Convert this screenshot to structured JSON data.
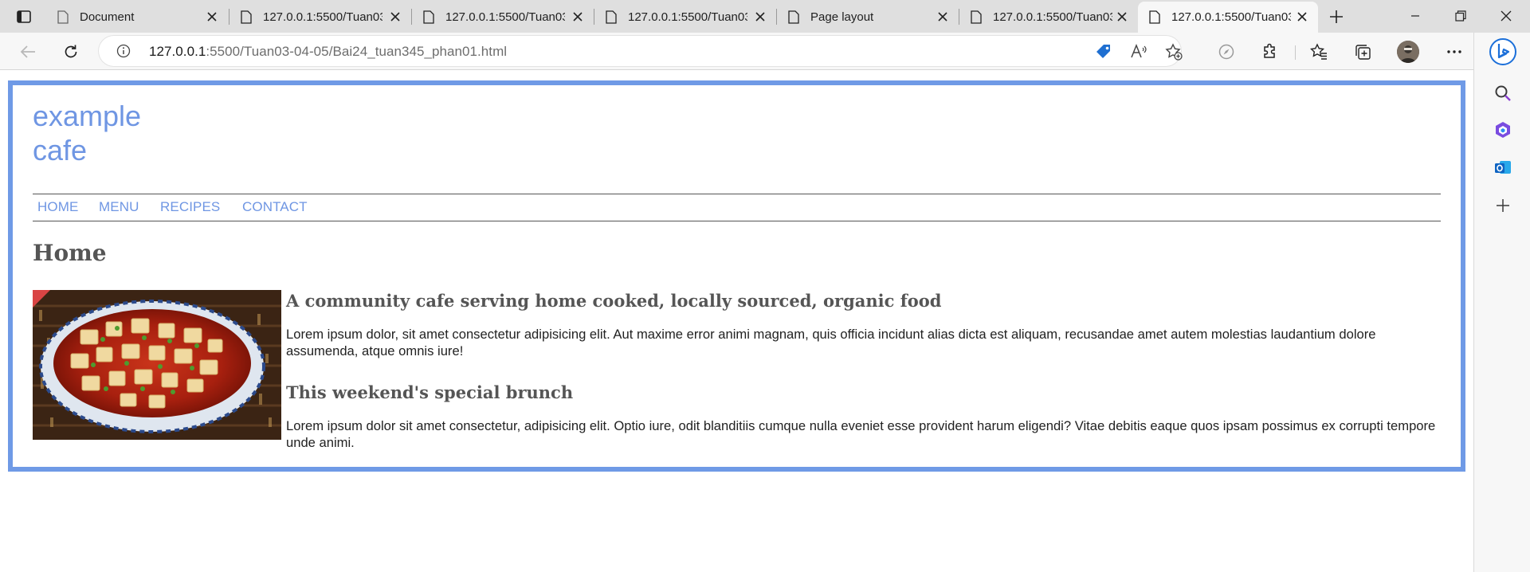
{
  "browser": {
    "tabs": [
      {
        "label": "Document"
      },
      {
        "label": "127.0.0.1:5500/Tuan03"
      },
      {
        "label": "127.0.0.1:5500/Tuan03"
      },
      {
        "label": "127.0.0.1:5500/Tuan03"
      },
      {
        "label": "Page layout"
      },
      {
        "label": "127.0.0.1:5500/Tuan03"
      },
      {
        "label": "127.0.0.1:5500/Tuan03",
        "active": true
      }
    ],
    "url_host": "127.0.0.1",
    "url_path": ":5500/Tuan03-04-05/Bai24_tuan345_phan01.html"
  },
  "site": {
    "logo_line1": "example",
    "logo_line2": "cafe",
    "nav": [
      {
        "label": "HOME"
      },
      {
        "label": "MENU"
      },
      {
        "label": "RECIPES"
      },
      {
        "label": "CONTACT"
      }
    ],
    "page_title": "Home",
    "section1_heading": "A community cafe serving home cooked, locally sourced, organic food",
    "section1_text": "Lorem ipsum dolor, sit amet consectetur adipisicing elit. Aut maxime error animi magnam, quis officia incidunt alias dicta est aliquam, recusandae amet autem molestias laudantium dolore assumenda, atque omnis iure!",
    "section2_heading": "This weekend's special brunch",
    "section2_text": "Lorem ipsum dolor sit amet consectetur, adipisicing elit. Optio iure, odit blanditiis cumque nulla eveniet esse provident harum eligendi? Vitae debitis eaque quos ipsam possimus ex corrupti tempore unde animi."
  },
  "colors": {
    "accent": "#6f96e3",
    "border": "#6f9ae6",
    "heading": "#555555"
  }
}
